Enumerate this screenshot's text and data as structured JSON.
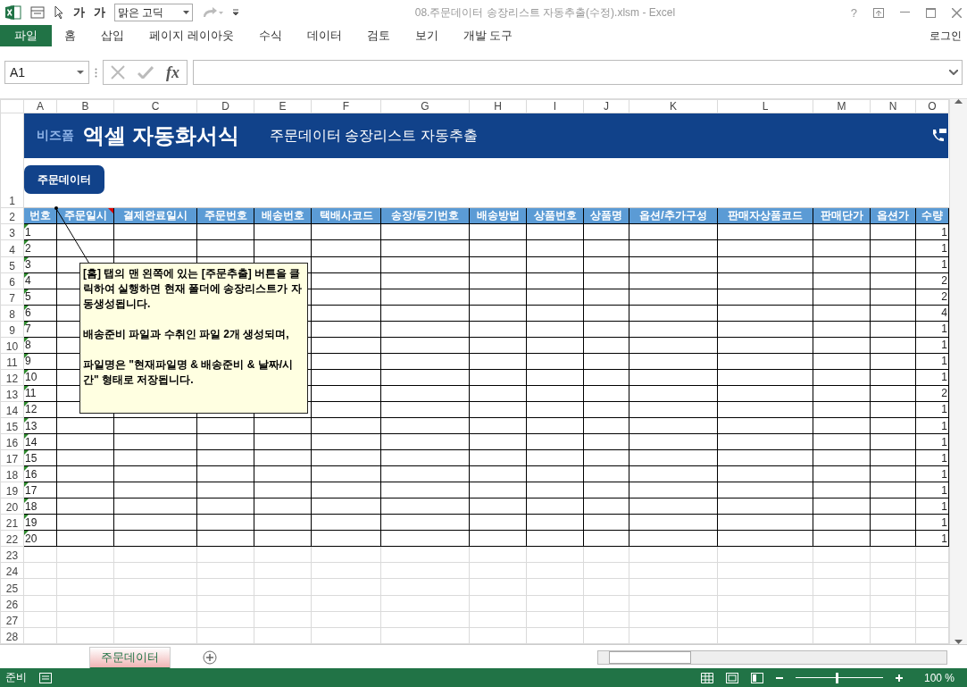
{
  "window": {
    "title": "08.주문데이터 송장리스트 자동추출(수정).xlsm - Excel",
    "help": "?"
  },
  "quick_access": {
    "font_grow": "가",
    "font_shrink": "가",
    "font_name": "맑은 고딕"
  },
  "ribbon_tabs": [
    {
      "label": "파일",
      "selected": true
    },
    {
      "label": "홈",
      "selected": false
    },
    {
      "label": "삽입",
      "selected": false
    },
    {
      "label": "페이지 레이아웃",
      "selected": false
    },
    {
      "label": "수식",
      "selected": false
    },
    {
      "label": "데이터",
      "selected": false
    },
    {
      "label": "검토",
      "selected": false
    },
    {
      "label": "보기",
      "selected": false
    },
    {
      "label": "개발 도구",
      "selected": false
    }
  ],
  "account": "로그인",
  "name_box": "A1",
  "formula_bar": {
    "fx": "fx"
  },
  "columns": [
    "A",
    "B",
    "C",
    "D",
    "E",
    "F",
    "G",
    "H",
    "I",
    "J",
    "K",
    "L",
    "M",
    "N",
    "O"
  ],
  "row_numbers": [
    "1",
    "2",
    "3",
    "4",
    "5",
    "6",
    "7",
    "8",
    "9",
    "10",
    "11",
    "12",
    "13",
    "14",
    "15",
    "16",
    "17",
    "18",
    "19",
    "20",
    "21",
    "22",
    "23",
    "24",
    "25",
    "26",
    "27",
    "28"
  ],
  "banner": {
    "brand": "비즈폼",
    "title": "엑셀 자동화서식",
    "subtitle": "주문데이터 송장리스트 자동추출"
  },
  "sheet_button": "주문데이터",
  "table": {
    "headers": [
      "번호",
      "주문일시",
      "결제완료일시",
      "주문번호",
      "배송번호",
      "택배사코드",
      "송장/등기번호",
      "배송방법",
      "상품번호",
      "상품명",
      "옵션/추가구성",
      "판매자상품코드",
      "판매단가",
      "옵션가",
      "수량"
    ],
    "rows": [
      {
        "no": "1",
        "qty": "1"
      },
      {
        "no": "2",
        "qty": "1"
      },
      {
        "no": "3",
        "qty": "1"
      },
      {
        "no": "4",
        "qty": "2"
      },
      {
        "no": "5",
        "qty": "2"
      },
      {
        "no": "6",
        "qty": "4"
      },
      {
        "no": "7",
        "qty": "1"
      },
      {
        "no": "8",
        "qty": "1"
      },
      {
        "no": "9",
        "qty": "1"
      },
      {
        "no": "10",
        "qty": "1"
      },
      {
        "no": "11",
        "qty": "2"
      },
      {
        "no": "12",
        "qty": "1"
      },
      {
        "no": "13",
        "qty": "1"
      },
      {
        "no": "14",
        "qty": "1"
      },
      {
        "no": "15",
        "qty": "1"
      },
      {
        "no": "16",
        "qty": "1"
      },
      {
        "no": "17",
        "qty": "1"
      },
      {
        "no": "18",
        "qty": "1"
      },
      {
        "no": "19",
        "qty": "1"
      },
      {
        "no": "20",
        "qty": "1"
      }
    ]
  },
  "comment": [
    "[홈] 탭의 맨 왼쪽에 있는 [주문추출] 버튼을 클릭하여 실행하면 현재 폴더에 송장리스트가 자동생성됩니다.",
    "배송준비 파일과 수취인 파일 2개 생성되며,",
    "파일명은 \"현재파일명 & 배송준비 & 날짜/시간\" 형태로 저장됩니다."
  ],
  "sheet_tabs": [
    {
      "label": "주문데이터",
      "selected": true
    }
  ],
  "status_bar": {
    "status": "준비",
    "zoom_slider": {
      "level": 0.47
    },
    "zoom": "100 %"
  }
}
